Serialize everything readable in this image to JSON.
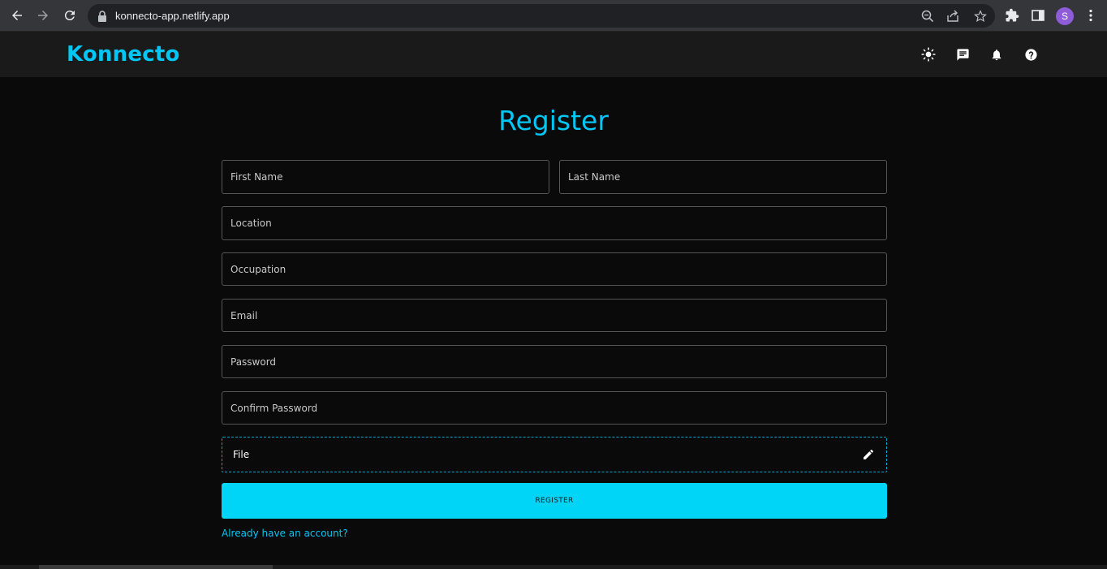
{
  "browser": {
    "url": "konnecto-app.netlify.app",
    "profile_initial": "S",
    "profile_color": "#8e5cd9"
  },
  "header": {
    "brand": "Konnecto",
    "brand_color": "#00c7f5",
    "icons": [
      "sun-icon",
      "message-icon",
      "bell-icon",
      "help-icon"
    ]
  },
  "form": {
    "title": "Register",
    "first_name_placeholder": "First Name",
    "last_name_placeholder": "Last Name",
    "location_placeholder": "Location",
    "occupation_placeholder": "Occupation",
    "email_placeholder": "Email",
    "password_placeholder": "Password",
    "confirm_password_placeholder": "Confirm Password",
    "file_label": "File",
    "submit_label": "REGISTER",
    "login_link": "Already have an account?",
    "accent": "#00d5f8"
  }
}
